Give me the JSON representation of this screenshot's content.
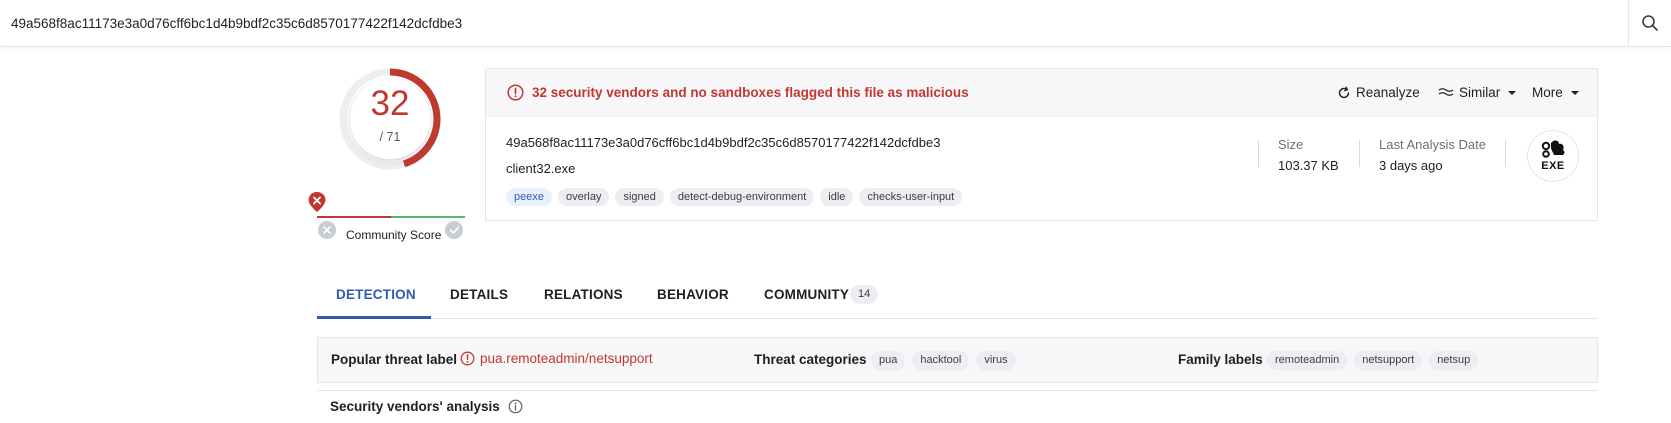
{
  "search": {
    "value": "49a568f8ac11173e3a0d76cff6bc1d4b9bdf2c35c6d8570177422f142dcfdbe3"
  },
  "score": {
    "detections": "32",
    "total": "/ 71",
    "fraction": 0.4507,
    "color": "#c0392f"
  },
  "community": {
    "label": "Community Score"
  },
  "alert": {
    "text": "32 security vendors and no sandboxes flagged this file as malicious"
  },
  "actions": {
    "reanalyze": "Reanalyze",
    "similar": "Similar",
    "more": "More"
  },
  "file": {
    "hash": "49a568f8ac11173e3a0d76cff6bc1d4b9bdf2c35c6d8570177422f142dcfdbe3",
    "name": "client32.exe",
    "tags": [
      "peexe",
      "overlay",
      "signed",
      "detect-debug-environment",
      "idle",
      "checks-user-input"
    ]
  },
  "meta": {
    "size_label": "Size",
    "size_value": "103.37 KB",
    "date_label": "Last Analysis Date",
    "date_value": "3 days ago",
    "filetype": "EXE"
  },
  "tabs": {
    "detection": "DETECTION",
    "details": "DETAILS",
    "relations": "RELATIONS",
    "behavior": "BEHAVIOR",
    "community": "COMMUNITY",
    "community_count": "14"
  },
  "threat": {
    "popular_label": "Popular threat label",
    "popular_value": "pua.remoteadmin/netsupport",
    "categories_label": "Threat categories",
    "categories": [
      "pua",
      "hacktool",
      "virus"
    ],
    "family_label": "Family labels",
    "families": [
      "remoteadmin",
      "netsupport",
      "netsup"
    ]
  },
  "section": {
    "vendors_title": "Security vendors' analysis"
  },
  "colors": {
    "malicious": "#c0392f",
    "accent": "#2f5bb5",
    "clean": "#5cb85c"
  }
}
